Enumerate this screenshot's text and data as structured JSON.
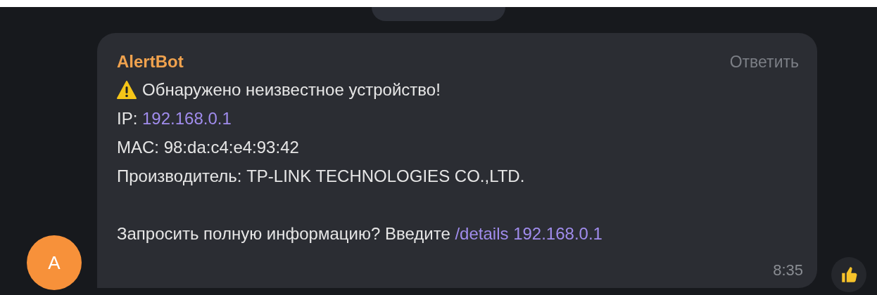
{
  "date_badge": {
    "kind": "pill"
  },
  "message": {
    "sender": "AlertBot",
    "reply_label": "Ответить",
    "avatar_letter": "A",
    "time": "8:35",
    "lines": [
      {
        "kind": "warning",
        "parts": [
          {
            "text": "Обнаружено неизвестное устройство!"
          }
        ]
      },
      {
        "parts": [
          {
            "text": "IP: "
          },
          {
            "text": "192.168.0.1",
            "kind": "link"
          }
        ]
      },
      {
        "parts": [
          {
            "text": "MAC: 98:da:c4:e4:93:42"
          }
        ]
      },
      {
        "parts": [
          {
            "text": "Производитель: TP-LINK TECHNOLOGIES CO.,LTD."
          }
        ]
      },
      {
        "kind": "blank"
      },
      {
        "parts": [
          {
            "text": "Запросить полную информацию? Введите "
          },
          {
            "text": "/details 192.168.0.1",
            "kind": "link"
          }
        ]
      }
    ],
    "reactions": [
      {
        "kind": "thumbs-up"
      }
    ]
  }
}
